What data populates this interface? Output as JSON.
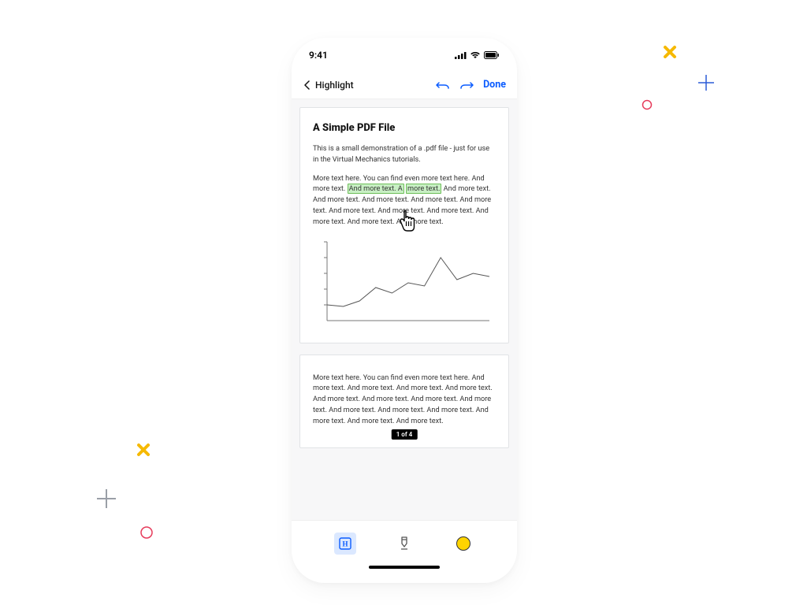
{
  "status": {
    "time": "9:41"
  },
  "nav": {
    "title": "Highlight",
    "done_label": "Done"
  },
  "doc": {
    "page1": {
      "heading": "A Simple PDF File",
      "intro": "This is a small demonstration of a .pdf file - just for use in the Virtual Mechanics tutorials.",
      "para_pre": "More text here. You can find even more text here. And more text. ",
      "hl1": "And more text. A",
      "mid": "  ",
      "hl2": "more text.",
      "para_post": " And more text. And more text. And more text. And more text. And more text. And more text. And more text. And more text. And more text. And more text. And more text."
    },
    "page2": {
      "para": "More text here. You can find even more text here. And more text. And more text. And more text. And more text. And more text. And more text. And more text. And more text. And more text. And more text. And more text. And more text. And more text. And more text."
    },
    "page_indicator": "1 of 4"
  },
  "toolbar": {
    "highlight_label": "H",
    "marker_label": "marker",
    "color": "#ffd400"
  },
  "chart_data": {
    "type": "line",
    "x": [
      0,
      1,
      2,
      3,
      4,
      5,
      6,
      7,
      8,
      9,
      10
    ],
    "y": [
      20,
      18,
      25,
      42,
      35,
      48,
      44,
      80,
      52,
      60,
      56
    ],
    "xlabel": "",
    "ylabel": "",
    "xlim": [
      0,
      10
    ],
    "ylim": [
      0,
      100
    ]
  }
}
